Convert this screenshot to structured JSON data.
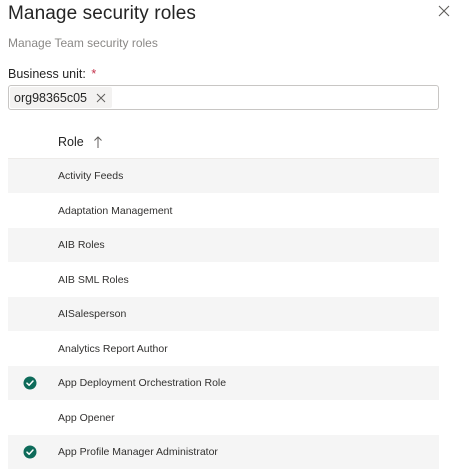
{
  "dialog": {
    "title": "Manage security roles",
    "subtitle": "Manage Team security roles",
    "close_icon": "close-icon"
  },
  "business_unit": {
    "label": "Business unit:",
    "required_marker": "*",
    "value": "org98365c05",
    "remove_icon": "dismiss-icon"
  },
  "grid": {
    "column_header": "Role",
    "sort_icon": "arrow-up-icon",
    "rows": [
      {
        "label": "Activity Feeds",
        "selected": false
      },
      {
        "label": "Adaptation Management",
        "selected": false
      },
      {
        "label": "AIB Roles",
        "selected": false
      },
      {
        "label": "AIB SML Roles",
        "selected": false
      },
      {
        "label": "AISalesperson",
        "selected": false
      },
      {
        "label": "Analytics Report Author",
        "selected": false
      },
      {
        "label": "App Deployment Orchestration Role",
        "selected": true
      },
      {
        "label": "App Opener",
        "selected": false
      },
      {
        "label": "App Profile Manager Administrator",
        "selected": true
      }
    ]
  },
  "colors": {
    "check_fill": "#0e6b5a",
    "row_alt_bg": "#f5f5f5",
    "required": "#c4314b"
  }
}
